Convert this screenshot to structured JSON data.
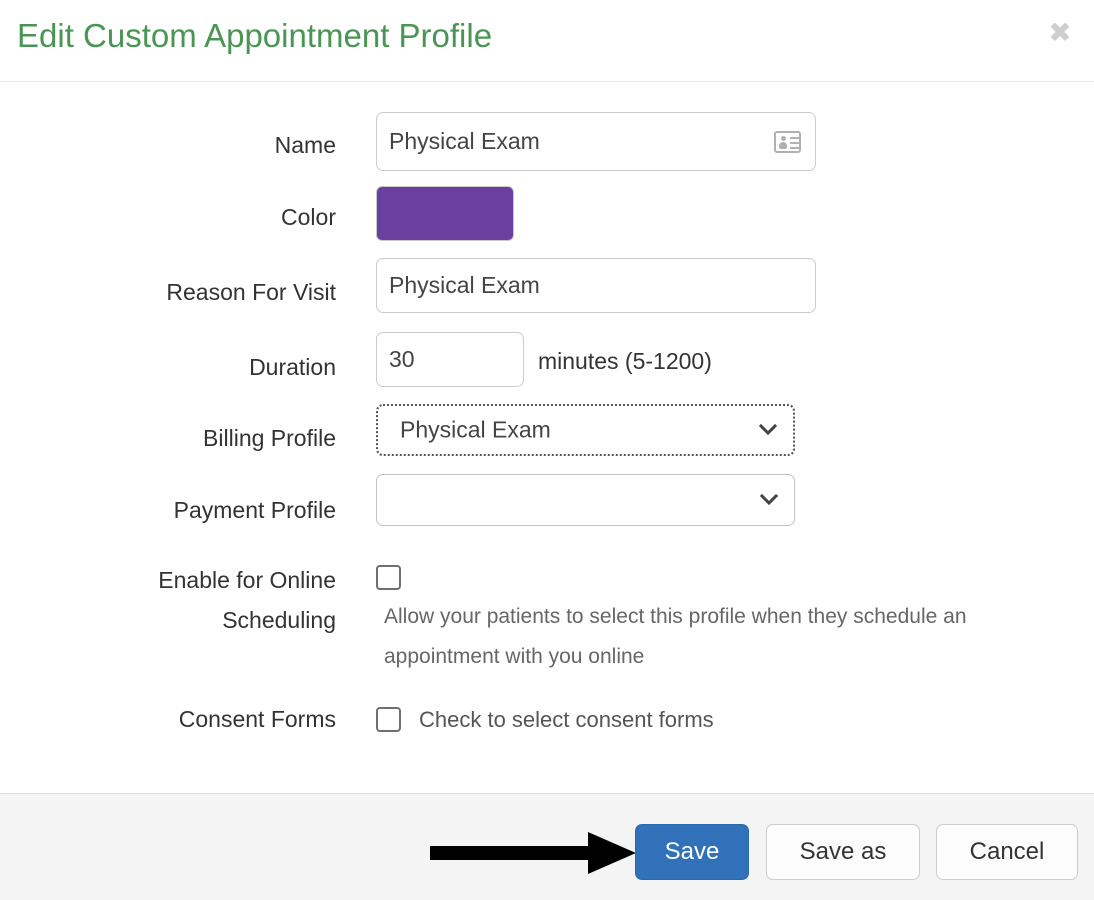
{
  "header": {
    "title": "Edit Custom Appointment Profile",
    "close_label": "✖",
    "close_icon": "close-icon",
    "title_color": "#499654"
  },
  "form": {
    "name": {
      "label": "Name",
      "value": "Physical Exam",
      "placeholder": "",
      "icon": "contact-card-icon"
    },
    "color": {
      "label": "Color",
      "value": "#6b3fa0"
    },
    "reason_for_visit": {
      "label": "Reason For Visit",
      "value": "Physical Exam",
      "placeholder": ""
    },
    "duration": {
      "label": "Duration",
      "value": "30",
      "placeholder": "",
      "unit_text": "minutes (5-1200)"
    },
    "billing_profile": {
      "label": "Billing Profile",
      "value": "Physical Exam",
      "options": [
        "Physical Exam"
      ],
      "icon": "chevron-down-icon"
    },
    "payment_profile": {
      "label": "Payment Profile",
      "value": "",
      "options": [
        ""
      ],
      "icon": "chevron-down-icon"
    },
    "online_scheduling": {
      "label_line1": "Enable for Online",
      "label_line2": "Scheduling",
      "checked": false,
      "helper_text": "Allow your patients to select this profile when they schedule an appointment with you online"
    },
    "consent_forms": {
      "label": "Consent Forms",
      "checked": false,
      "inline_text": "Check to select consent forms"
    }
  },
  "footer": {
    "save_label": "Save",
    "save_as_label": "Save as",
    "cancel_label": "Cancel",
    "primary_color": "#3071b9"
  },
  "annotation": {
    "arrow": "arrow-pointing-to-save-button",
    "color": "#000000"
  }
}
